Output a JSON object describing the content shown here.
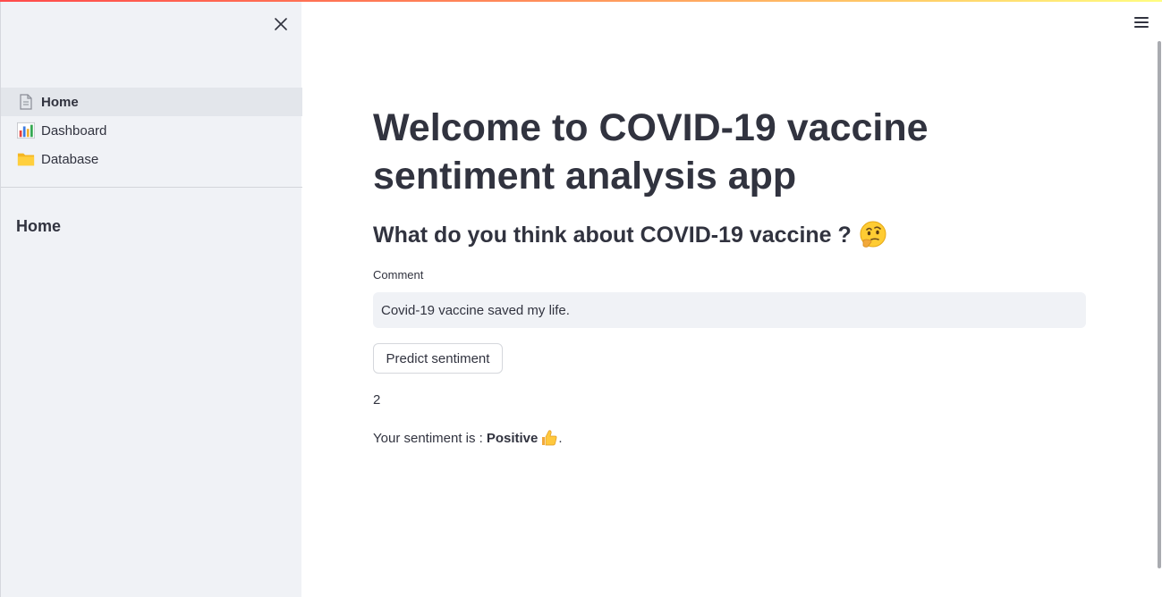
{
  "sidebar": {
    "nav": [
      {
        "label": "Home",
        "icon": "document-icon",
        "active": true
      },
      {
        "label": "Dashboard",
        "icon": "bar-chart-icon",
        "active": false
      },
      {
        "label": "Database",
        "icon": "folder-icon",
        "active": false
      }
    ],
    "section_heading": "Home"
  },
  "main": {
    "title": "Welcome to COVID-19 vaccine sentiment analysis app",
    "question": "What do you think about COVID-19 vaccine ?",
    "comment_label": "Comment",
    "comment_value": "Covid-19 vaccine saved my life.",
    "predict_button": "Predict sentiment",
    "prediction_number": "2",
    "sentiment_prefix": "Your sentiment is :",
    "sentiment_value": "Positive",
    "sentiment_suffix": "."
  },
  "colors": {
    "sidebar_bg": "#f0f2f6",
    "text": "#31333f",
    "active_item_bg": "#e3e6eb"
  }
}
